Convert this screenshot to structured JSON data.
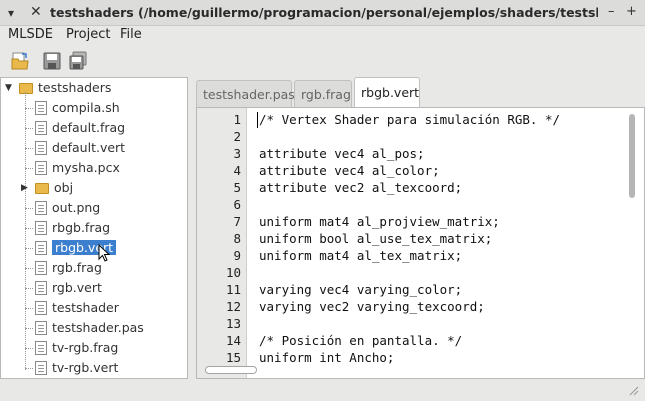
{
  "window": {
    "title": "testshaders (/home/guillermo/programacion/personal/ejemplos/shaders/testshaders) - MLSDE",
    "close_glyph": "✕",
    "minimize_glyph": "–",
    "maximize_glyph": "+"
  },
  "menubar": {
    "items": [
      "MLSDE",
      "Project",
      "File"
    ]
  },
  "toolbar": {
    "buttons": [
      "open-folder-icon",
      "save-icon",
      "save-all-icon"
    ]
  },
  "project_tree": {
    "root": "testshaders",
    "items": [
      {
        "label": "compila.sh",
        "type": "file"
      },
      {
        "label": "default.frag",
        "type": "file"
      },
      {
        "label": "default.vert",
        "type": "file"
      },
      {
        "label": "mysha.pcx",
        "type": "file"
      },
      {
        "label": "obj",
        "type": "folder",
        "collapsed": true
      },
      {
        "label": "out.png",
        "type": "file"
      },
      {
        "label": "rbgb.frag",
        "type": "file"
      },
      {
        "label": "rbgb.vert",
        "type": "file",
        "selected": true
      },
      {
        "label": "rgb.frag",
        "type": "file"
      },
      {
        "label": "rgb.vert",
        "type": "file"
      },
      {
        "label": "testshader",
        "type": "file"
      },
      {
        "label": "testshader.pas",
        "type": "file"
      },
      {
        "label": "tv-rgb.frag",
        "type": "file"
      },
      {
        "label": "tv-rgb.vert",
        "type": "file"
      }
    ]
  },
  "tabs": [
    {
      "label": "testshader.pas",
      "active": false
    },
    {
      "label": "rgb.frag",
      "active": false
    },
    {
      "label": "rbgb.vert",
      "active": true
    }
  ],
  "editor": {
    "lines": [
      "/* Vertex Shader para simulación RGB. */",
      "",
      "attribute vec4 al_pos;",
      "attribute vec4 al_color;",
      "attribute vec2 al_texcoord;",
      "",
      "uniform mat4 al_projview_matrix;",
      "uniform bool al_use_tex_matrix;",
      "uniform mat4 al_tex_matrix;",
      "",
      "varying vec4 varying_color;",
      "varying vec2 varying_texcoord;",
      "",
      "/* Posición en pantalla. */",
      "uniform int Ancho;"
    ],
    "line_numbers": [
      "1",
      "2",
      "3",
      "4",
      "5",
      "6",
      "7",
      "8",
      "9",
      "10",
      "11",
      "12",
      "13",
      "14",
      "15"
    ],
    "current_line": 1
  },
  "colors": {
    "selection": "#3d7fcf",
    "folder": "#e9b94b",
    "gutter": "#e8e8e7"
  }
}
